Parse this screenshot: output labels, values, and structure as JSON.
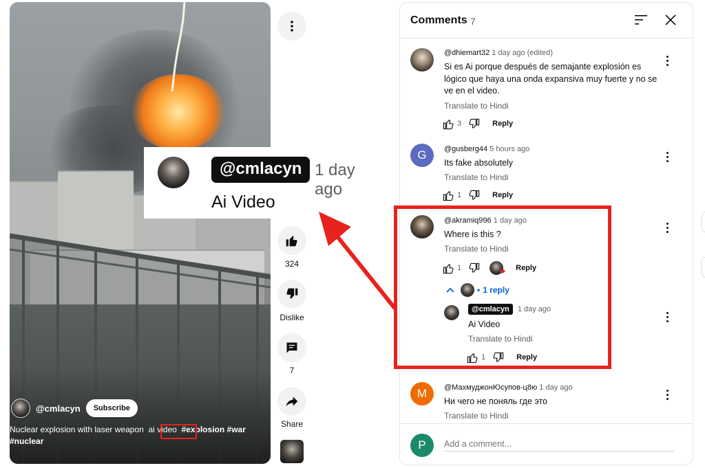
{
  "video": {
    "channel_handle": "@cmlacyn",
    "subscribe_label": "Subscribe",
    "caption_text": "Nuclear explosion with laser weapon",
    "caption_tag_plain": "ai video",
    "caption_tags_bold": "#explosion #war",
    "caption_tags_bold_2": "#nuclear"
  },
  "rail": {
    "likes": "324",
    "dislike_label": "Dislike",
    "comments": "7",
    "share_label": "Share"
  },
  "callout": {
    "handle": "@cmlacyn",
    "time": "1 day ago",
    "text": "Ai Video"
  },
  "comments_panel": {
    "title": "Comments",
    "count": "7",
    "items": [
      {
        "author": "@dhiemart32",
        "time": "1 day ago (edited)",
        "text": "Si es Ai porque después de semajante explosión es lógico que haya una onda expansiva muy fuerte y no se ve en el video.",
        "translate": "Translate to Hindi",
        "likes": "3",
        "reply": "Reply"
      },
      {
        "author": "@gusberg44",
        "time": "5 hours ago",
        "avatar_letter": "G",
        "text": "Its fake absolutely",
        "translate": "Translate to Hindi",
        "likes": "1",
        "reply": "Reply"
      },
      {
        "author": "@akramiq996",
        "time": "1 day ago",
        "text": "Where is this ?",
        "translate": "Translate to Hindi",
        "likes": "1",
        "reply": "Reply",
        "replies_label": "1 reply",
        "reply_item": {
          "author": "@cmlacyn",
          "time": "1 day ago",
          "text": "Ai Video",
          "translate": "Translate to Hindi",
          "likes": "1",
          "reply": "Reply"
        }
      },
      {
        "author": "@МахмуджонЮсупов-ц8ю",
        "time": "1 day ago",
        "avatar_letter": "M",
        "text": "Ни чего не поняль где это",
        "translate": "Translate to Hindi"
      }
    ],
    "add_avatar_letter": "P",
    "add_placeholder": "Add a comment..."
  },
  "colors": {
    "highlight_red": "#e8221c",
    "link_blue": "#065fd4",
    "avatar_g": "#5c6bc0",
    "avatar_m": "#ef6c00",
    "avatar_p": "#1b8a6b"
  }
}
